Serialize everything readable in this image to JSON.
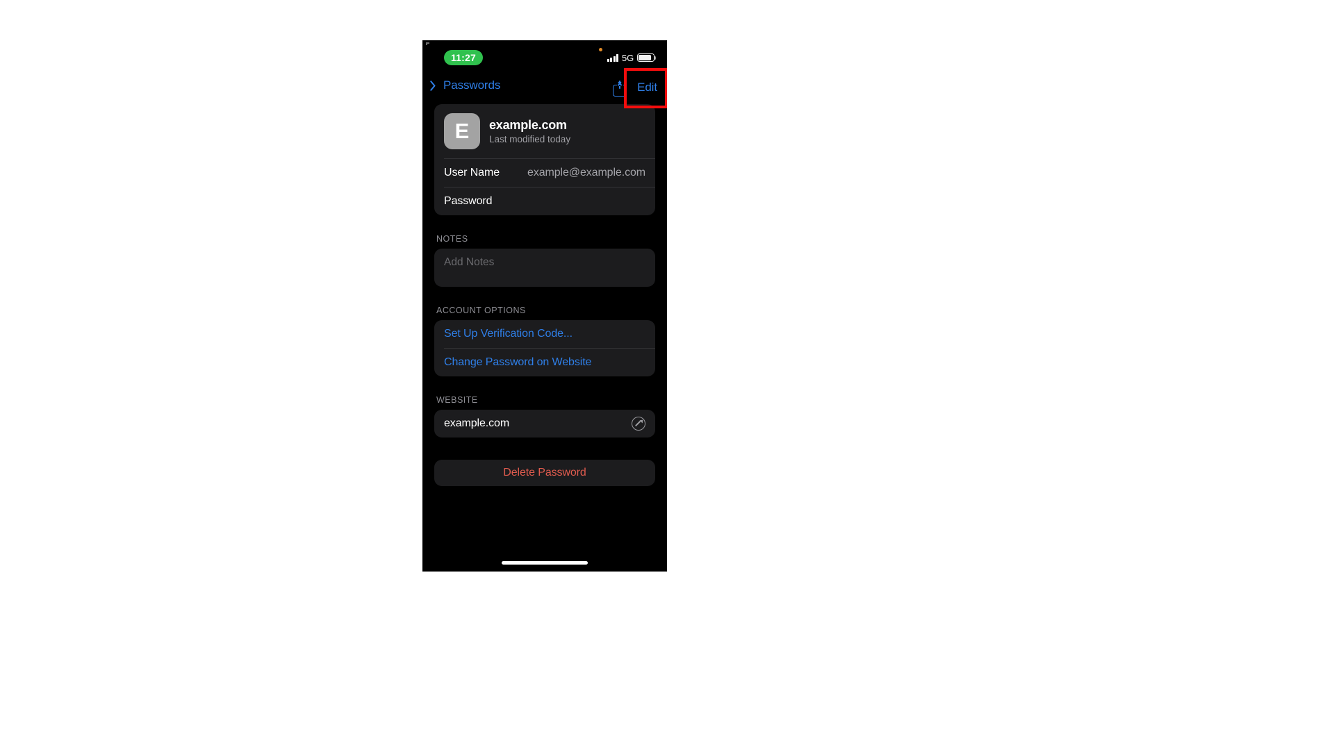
{
  "status_bar": {
    "time": "11:27",
    "network_label": "5G",
    "recording_indicator": "orange-dot",
    "signal_icon": "cellular-signal-icon",
    "battery_icon": "battery-icon"
  },
  "nav_bar": {
    "back_label": "Passwords",
    "back_icon": "chevron-left-icon",
    "share_icon": "share-icon",
    "edit_label": "Edit"
  },
  "annotation": {
    "highlight_color": "#f40d0d",
    "target": "Edit"
  },
  "detail": {
    "avatar_letter": "E",
    "site_name": "example.com",
    "last_modified": "Last modified today",
    "fields": [
      {
        "label": "User Name",
        "value": "example@example.com"
      },
      {
        "label": "Password",
        "value": ""
      }
    ]
  },
  "notes": {
    "section_title": "NOTES",
    "placeholder": "Add Notes",
    "value": ""
  },
  "account_options": {
    "section_title": "ACCOUNT OPTIONS",
    "items": [
      {
        "label": "Set Up Verification Code..."
      },
      {
        "label": "Change Password on Website"
      }
    ]
  },
  "website": {
    "section_title": "WEBSITE",
    "value": "example.com",
    "open_icon": "safari-compass-icon"
  },
  "delete": {
    "label": "Delete Password"
  },
  "colors": {
    "accent_blue": "#2f7fe8",
    "destructive_red": "#e05b4e",
    "card_bg": "#1c1c1e",
    "screen_bg": "#000000",
    "status_green": "#30c14e"
  }
}
